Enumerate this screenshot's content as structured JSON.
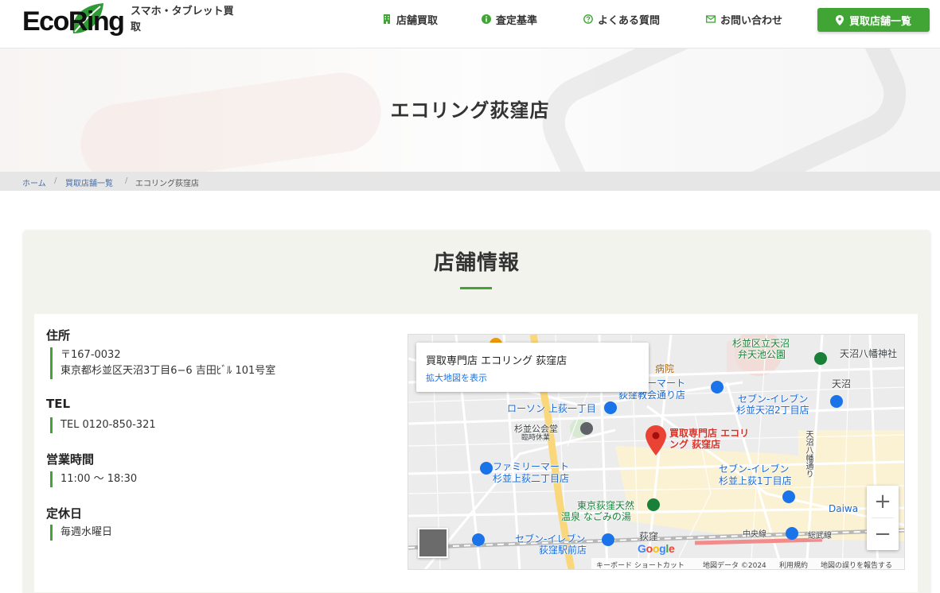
{
  "header": {
    "logo_text": "EcoRing",
    "tagline": "スマホ・タブレット買取",
    "nav": [
      {
        "label": "店舗買取",
        "icon": "building-icon"
      },
      {
        "label": "査定基準",
        "icon": "info-circle-icon"
      },
      {
        "label": "よくある質問",
        "icon": "question-circle-icon"
      },
      {
        "label": "お問い合わせ",
        "icon": "envelope-icon"
      }
    ],
    "cta": {
      "label": "買取店舗一覧",
      "icon": "map-marker-icon"
    }
  },
  "hero": {
    "title": "エコリング荻窪店"
  },
  "breadcrumb": {
    "items": [
      "ホーム",
      "買取店舗一覧",
      "エコリング荻窪店"
    ],
    "separator": "/"
  },
  "store": {
    "section_title": "店舗情報",
    "address_label": "住所",
    "postal": "〒167-0032",
    "address": "東京都杉並区天沼3丁目6−6 吉田ﾋﾞﾙ 101号室",
    "tel_label": "TEL",
    "tel": "TEL 0120-850-321",
    "hours_label": "営業時間",
    "hours": "11:00 〜 18:30",
    "closed_label": "定休日",
    "closed": "毎週水曜日"
  },
  "map": {
    "popup_title": "買取専門店 エコリング 荻窪店",
    "popup_link": "拡大地図を表示",
    "pin_label": "買取専門店 エコリング 荻窪店",
    "zoom_in": "+",
    "zoom_out": "−",
    "google": "Google",
    "footer": [
      "キーボード ショートカット",
      "地図データ ©2024",
      "利用規約",
      "地図の誤りを報告する"
    ],
    "places": [
      {
        "text": "杉並区立天沼",
        "color": "green"
      },
      {
        "text": "弁天池公園",
        "color": "green"
      },
      {
        "text": "天沼八幡神社",
        "color": "dark"
      },
      {
        "text": "天沼",
        "color": "dark"
      },
      {
        "text": "病院",
        "color": "orange"
      },
      {
        "text": "ーマート",
        "color": "blue"
      },
      {
        "text": "荻窪教会通り店",
        "color": "blue"
      },
      {
        "text": "セブン-イレブン",
        "color": "blue"
      },
      {
        "text": "杉並天沼2丁目店",
        "color": "blue"
      },
      {
        "text": "ローソン 上荻一丁目",
        "color": "blue"
      },
      {
        "text": "杉並公会堂",
        "color": "dark"
      },
      {
        "text": "臨時休業",
        "color": "dark"
      },
      {
        "text": "ファミリーマート",
        "color": "blue"
      },
      {
        "text": "杉並上荻二丁目店",
        "color": "blue"
      },
      {
        "text": "セブン-イレブン",
        "color": "blue"
      },
      {
        "text": "杉並上荻1丁目店",
        "color": "blue"
      },
      {
        "text": "東京荻窪天然",
        "color": "green"
      },
      {
        "text": "温泉 なごみの湯",
        "color": "green"
      },
      {
        "text": "セブン-イレブン",
        "color": "blue"
      },
      {
        "text": "荻窪駅前店",
        "color": "blue"
      },
      {
        "text": "荻窪",
        "color": "dark"
      },
      {
        "text": "中央線",
        "color": "dark"
      },
      {
        "text": "総武線",
        "color": "dark"
      },
      {
        "text": "天沼八幡通り",
        "color": "dark"
      },
      {
        "text": "Daiwa",
        "color": "blue"
      }
    ]
  }
}
